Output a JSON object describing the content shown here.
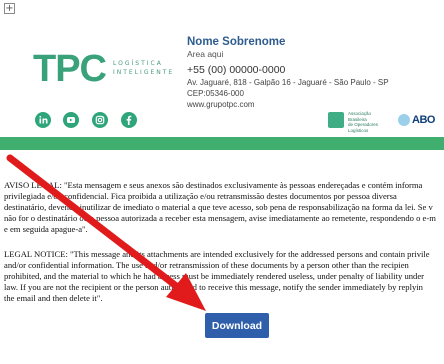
{
  "expand_toggle": "+",
  "logo": {
    "text": "TPC",
    "subtitle_1": "LOGÍSTICA",
    "subtitle_2": "INTELIGENTE",
    "color": "#3aa27a"
  },
  "contact": {
    "name": "Nome Sobrenome",
    "area": "Area aqui",
    "phone": "+55 (00) 00000-0000",
    "address": "Av. Jaguaré, 818 - Galpão 16 - Jaguaré - São Paulo - SP",
    "cep": "CEP:05346-000",
    "website": "www.grupotpc.com"
  },
  "social_icons": [
    "linkedin-icon",
    "youtube-icon",
    "instagram-icon",
    "facebook-icon"
  ],
  "association": {
    "line1": "Associação Brasileira",
    "line2": "de Operadores",
    "line3": "Logísticos"
  },
  "abo_logo": "ABO",
  "accent_color": "#3fae6f",
  "legal_pt": [
    "AVISO LEGAL: \"Esta mensagem e seus anexos são destinados exclusivamente às pessoas endereçadas e contém informa",
    "privilegiada e/ou confidencial. Fica proibida a utilização e/ou retransmissão destes documentos por pessoa diversa",
    "destinatário, devendo inutilizar de imediato o material a que teve acesso, sob pena de responsabilização na forma da lei. Se v",
    "não for o destinatário ou a pessoa autorizada a receber esta mensagem, avise imediatamente ao remetente, respondendo o e-m",
    "e em seguida apague-a\"."
  ],
  "legal_en": [
    "LEGAL NOTICE: \"This message and its attachments are intended exclusively for the addressed persons and contain privile",
    "and/or confidential information. The use and/or retransmission of these documents by a person other than the recipien",
    "prohibited, and the material to which he had access must be immediately rendered useless, under penalty of liability under",
    "law. If you are not the recipient or the person authorized to receive this message, notify the sender immediately by replyin",
    "the email and then delete it\"."
  ],
  "download_button": "Download",
  "button_color": "#2f5fab",
  "arrow_color": "#e11b1b"
}
